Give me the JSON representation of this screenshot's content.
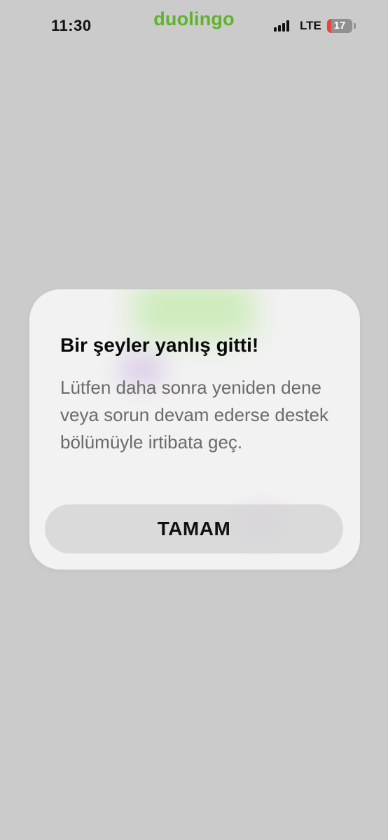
{
  "status_bar": {
    "time": "11:30",
    "app_name": "duolingo",
    "network": "LTE",
    "battery": "17",
    "battery_level": 0.17,
    "signal_icon": "signal-bars-icon",
    "battery_icon": "battery-icon"
  },
  "dialog": {
    "title": "Bir şeyler yanlış gitti!",
    "message": "Lütfen daha sonra yeniden dene veya sorun devam ederse destek bölümüyle irtibata geç.",
    "ok_label": "TAMAM"
  },
  "colors": {
    "backdrop": "#cbcbcb",
    "brand_green": "#5fb32b",
    "battery_low": "#e5453a",
    "dialog_bg": "#f4f4f4",
    "button_bg": "#d6d6d6"
  }
}
